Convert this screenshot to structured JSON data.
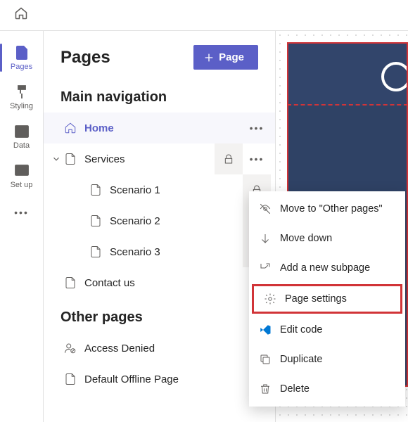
{
  "rail": {
    "items": [
      {
        "label": "Pages"
      },
      {
        "label": "Styling"
      },
      {
        "label": "Data"
      },
      {
        "label": "Set up"
      }
    ]
  },
  "panel": {
    "title": "Pages",
    "add_button": "Page",
    "section_main": "Main navigation",
    "section_other": "Other pages",
    "tree": {
      "home": "Home",
      "services": "Services",
      "scenario1": "Scenario 1",
      "scenario2": "Scenario 2",
      "scenario3": "Scenario 3",
      "contact": "Contact us",
      "access_denied": "Access Denied",
      "offline": "Default Offline Page"
    }
  },
  "context_menu": {
    "move_other": "Move to \"Other pages\"",
    "move_down": "Move down",
    "add_sub": "Add a new subpage",
    "settings": "Page settings",
    "edit_code": "Edit code",
    "duplicate": "Duplicate",
    "delete": "Delete"
  }
}
